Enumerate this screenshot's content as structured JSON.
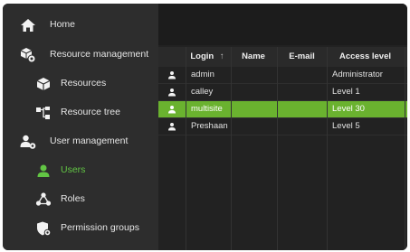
{
  "sidebar": {
    "items": [
      {
        "label": "Home",
        "icon": "home-icon",
        "active": false
      },
      {
        "label": "Resource management",
        "icon": "resource-management-icon",
        "active": false
      },
      {
        "label": "Resources",
        "icon": "cube-icon",
        "active": false
      },
      {
        "label": "Resource tree",
        "icon": "tree-icon",
        "active": false
      },
      {
        "label": "User management",
        "icon": "user-gear-icon",
        "active": false
      },
      {
        "label": "Users",
        "icon": "user-icon",
        "active": true
      },
      {
        "label": "Roles",
        "icon": "roles-icon",
        "active": false
      },
      {
        "label": "Permission groups",
        "icon": "permission-groups-icon",
        "active": false
      }
    ]
  },
  "table": {
    "columns": [
      {
        "label": "Login",
        "sort_indicator": "↑"
      },
      {
        "label": "Name"
      },
      {
        "label": "E-mail"
      },
      {
        "label": "Access level"
      }
    ],
    "rows": [
      {
        "login": "admin",
        "name": "",
        "email": "",
        "access_level": "Administrator",
        "selected": false
      },
      {
        "login": "calley",
        "name": "",
        "email": "",
        "access_level": "Level 1",
        "selected": false
      },
      {
        "login": "multisite",
        "name": "",
        "email": "",
        "access_level": "Level 30",
        "selected": true
      },
      {
        "login": "Preshaan",
        "name": "",
        "email": "",
        "access_level": "Level 5",
        "selected": false
      }
    ]
  },
  "colors": {
    "accent_green": "#62c544",
    "selected_row": "#6ab22f",
    "sidebar_bg": "#2d2d2d",
    "content_bg": "#222222"
  }
}
